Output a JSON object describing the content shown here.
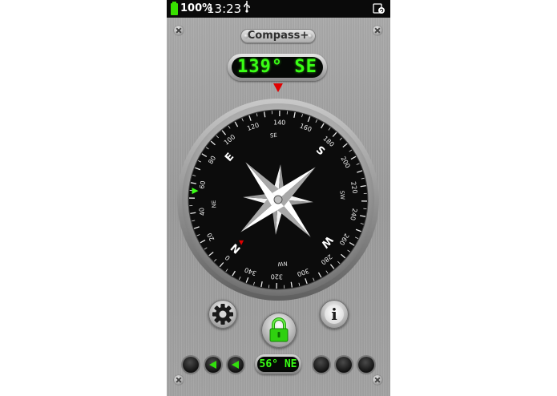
{
  "status_bar": {
    "battery": "100%",
    "time": "13:23",
    "usb_icon": "usb-icon",
    "rotation_icon": "screen-rotation-icon"
  },
  "app": {
    "title": "Compass+",
    "heading_readout": "139° SE",
    "secondary_readout": "56° NE"
  },
  "dial": {
    "degree_labels": [
      "140",
      "160",
      "180",
      "200",
      "220",
      "240",
      "260",
      "280",
      "300",
      "320",
      "340",
      "0",
      "20",
      "40",
      "60",
      "80",
      "100",
      "120"
    ],
    "cardinals": [
      "S",
      "W",
      "N",
      "E"
    ],
    "intercardinals": [
      "SE",
      "SW",
      "NW",
      "NE"
    ]
  },
  "controls": {
    "settings_icon": "gear-icon",
    "lock_icon": "padlock-icon",
    "info_icon": "info-icon",
    "info_glyph": "i"
  },
  "colors": {
    "lcd_green": "#39ff14",
    "marker_red": "#e00000",
    "dial_face": "#0c0c0c",
    "status_bar": "#0a0a0a"
  }
}
